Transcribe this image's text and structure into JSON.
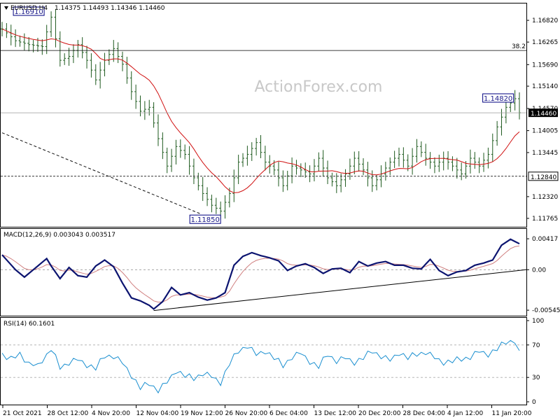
{
  "watermark": "ActionForex.com",
  "chart_data": [
    {
      "type": "candlestick",
      "title": "EURUSD,H4",
      "ohlc_label": "1.14375 1.14493 1.14346 1.14460",
      "ylim": [
        1.1155,
        1.1725
      ],
      "yticks": [
        "1.16820",
        "1.16265",
        "1.15690",
        "1.15140",
        "1.14570",
        "1.14005",
        "1.13445",
        "1.12320",
        "1.11765"
      ],
      "xticks": [
        "21 Oct 2021",
        "28 Oct 12:00",
        "4 Nov 20:00",
        "12 Nov 04:00",
        "19 Nov 12:00",
        "26 Nov 20:00",
        "6 Dec 04:00",
        "13 Dec 12:00",
        "20 Dec 20:00",
        "28 Dec 04:00",
        "4 Jan 12:00",
        "11 Jan 20:00"
      ],
      "current_price": "1.14460",
      "fib_label": "38.2",
      "fib_level": 1.1605,
      "support_label": "1.12840",
      "support_level": 1.1284,
      "annotations": [
        "1.16910",
        "1.11850",
        "1.14820"
      ],
      "moving_average": "red",
      "trendline": "dashed black, falling from Oct high area to 1.11850 low",
      "price_path": [
        [
          0,
          1.166
        ],
        [
          3,
          1.163
        ],
        [
          6,
          1.162
        ],
        [
          9,
          1.1615
        ],
        [
          11,
          1.169
        ],
        [
          13,
          1.158
        ],
        [
          15,
          1.159
        ],
        [
          17,
          1.162
        ],
        [
          19,
          1.158
        ],
        [
          21,
          1.153
        ],
        [
          23,
          1.158
        ],
        [
          25,
          1.161
        ],
        [
          27,
          1.157
        ],
        [
          29,
          1.15
        ],
        [
          31,
          1.145
        ],
        [
          33,
          1.146
        ],
        [
          35,
          1.138
        ],
        [
          37,
          1.131
        ],
        [
          39,
          1.136
        ],
        [
          41,
          1.134
        ],
        [
          43,
          1.128
        ],
        [
          45,
          1.124
        ],
        [
          47,
          1.121
        ],
        [
          49,
          1.1195
        ],
        [
          51,
          1.124
        ],
        [
          53,
          1.132
        ],
        [
          55,
          1.134
        ],
        [
          57,
          1.137
        ],
        [
          59,
          1.132
        ],
        [
          61,
          1.13
        ],
        [
          63,
          1.126
        ],
        [
          65,
          1.131
        ],
        [
          67,
          1.13
        ],
        [
          69,
          1.129
        ],
        [
          71,
          1.133
        ],
        [
          73,
          1.128
        ],
        [
          75,
          1.126
        ],
        [
          77,
          1.129
        ],
        [
          79,
          1.133
        ],
        [
          81,
          1.13
        ],
        [
          83,
          1.126
        ],
        [
          85,
          1.129
        ],
        [
          87,
          1.132
        ],
        [
          89,
          1.134
        ],
        [
          91,
          1.131
        ],
        [
          93,
          1.136
        ],
        [
          95,
          1.133
        ],
        [
          97,
          1.131
        ],
        [
          99,
          1.133
        ],
        [
          101,
          1.131
        ],
        [
          103,
          1.129
        ],
        [
          105,
          1.133
        ],
        [
          107,
          1.131
        ],
        [
          109,
          1.134
        ],
        [
          111,
          1.141
        ],
        [
          113,
          1.146
        ],
        [
          115,
          1.1482
        ],
        [
          116,
          1.1446
        ]
      ]
    },
    {
      "type": "line",
      "title": "MACD(12,26,9) 0.003043 0.003517",
      "ylim": [
        -0.0062,
        0.0055
      ],
      "yticks": [
        "0.00417",
        "0.00",
        "-0.005456"
      ],
      "current_label": "0.0035",
      "trendline": "rising support line from Nov 12 low to Jan",
      "macd": [
        [
          0,
          0.002
        ],
        [
          3,
          0.0
        ],
        [
          5,
          -0.001
        ],
        [
          7,
          0.0
        ],
        [
          9,
          0.001
        ],
        [
          10,
          0.0015
        ],
        [
          11,
          0.0005
        ],
        [
          13,
          -0.0012
        ],
        [
          15,
          0.0003
        ],
        [
          17,
          -0.0008
        ],
        [
          19,
          -0.001
        ],
        [
          21,
          0.0005
        ],
        [
          23,
          0.0013
        ],
        [
          25,
          0.0004
        ],
        [
          27,
          -0.0018
        ],
        [
          29,
          -0.0038
        ],
        [
          31,
          -0.0042
        ],
        [
          33,
          -0.0048
        ],
        [
          34,
          -0.0053
        ],
        [
          36,
          -0.0043
        ],
        [
          38,
          -0.0024
        ],
        [
          40,
          -0.0034
        ],
        [
          42,
          -0.0031
        ],
        [
          44,
          -0.0037
        ],
        [
          46,
          -0.0041
        ],
        [
          48,
          -0.0038
        ],
        [
          50,
          -0.0031
        ],
        [
          52,
          0.0006
        ],
        [
          54,
          0.0018
        ],
        [
          56,
          0.0023
        ],
        [
          58,
          0.0019
        ],
        [
          60,
          0.0016
        ],
        [
          62,
          0.0012
        ],
        [
          64,
          -0.0001
        ],
        [
          66,
          0.0005
        ],
        [
          68,
          0.0008
        ],
        [
          70,
          0.0003
        ],
        [
          72,
          -0.0005
        ],
        [
          74,
          0.0001
        ],
        [
          76,
          0.0002
        ],
        [
          78,
          -0.0004
        ],
        [
          80,
          0.0011
        ],
        [
          82,
          0.0005
        ],
        [
          84,
          0.0009
        ],
        [
          86,
          0.0011
        ],
        [
          88,
          0.0006
        ],
        [
          90,
          0.0006
        ],
        [
          92,
          0.0002
        ],
        [
          94,
          0.0001
        ],
        [
          96,
          0.0014
        ],
        [
          98,
          -0.0001
        ],
        [
          100,
          -0.0008
        ],
        [
          102,
          -0.0003
        ],
        [
          104,
          -0.0001
        ],
        [
          106,
          0.0006
        ],
        [
          108,
          0.0009
        ],
        [
          110,
          0.0013
        ],
        [
          112,
          0.0033
        ],
        [
          114,
          0.0041
        ],
        [
          116,
          0.0035
        ]
      ]
    },
    {
      "type": "line",
      "title": "RSI(14) 60.1601",
      "ylim": [
        0,
        100
      ],
      "yticks": [
        "100",
        "70",
        "30",
        "0"
      ],
      "levels": [
        70,
        30
      ],
      "rsi": [
        [
          0,
          58
        ],
        [
          2,
          52
        ],
        [
          4,
          60
        ],
        [
          6,
          46
        ],
        [
          8,
          45
        ],
        [
          10,
          57
        ],
        [
          11,
          66
        ],
        [
          13,
          42
        ],
        [
          15,
          49
        ],
        [
          17,
          52
        ],
        [
          19,
          45
        ],
        [
          21,
          42
        ],
        [
          23,
          56
        ],
        [
          25,
          57
        ],
        [
          27,
          48
        ],
        [
          29,
          32
        ],
        [
          31,
          18
        ],
        [
          33,
          22
        ],
        [
          35,
          15
        ],
        [
          37,
          24
        ],
        [
          39,
          38
        ],
        [
          41,
          33
        ],
        [
          43,
          28
        ],
        [
          45,
          36
        ],
        [
          47,
          31
        ],
        [
          49,
          23
        ],
        [
          51,
          48
        ],
        [
          53,
          62
        ],
        [
          55,
          70
        ],
        [
          57,
          58
        ],
        [
          59,
          62
        ],
        [
          61,
          55
        ],
        [
          63,
          44
        ],
        [
          65,
          56
        ],
        [
          67,
          60
        ],
        [
          69,
          49
        ],
        [
          71,
          44
        ],
        [
          73,
          58
        ],
        [
          75,
          51
        ],
        [
          77,
          54
        ],
        [
          79,
          48
        ],
        [
          81,
          55
        ],
        [
          83,
          62
        ],
        [
          85,
          57
        ],
        [
          87,
          51
        ],
        [
          89,
          60
        ],
        [
          91,
          55
        ],
        [
          93,
          58
        ],
        [
          95,
          62
        ],
        [
          97,
          54
        ],
        [
          99,
          48
        ],
        [
          101,
          51
        ],
        [
          103,
          52
        ],
        [
          105,
          56
        ],
        [
          107,
          62
        ],
        [
          109,
          58
        ],
        [
          111,
          66
        ],
        [
          113,
          73
        ],
        [
          115,
          76
        ],
        [
          116,
          60
        ]
      ]
    }
  ]
}
